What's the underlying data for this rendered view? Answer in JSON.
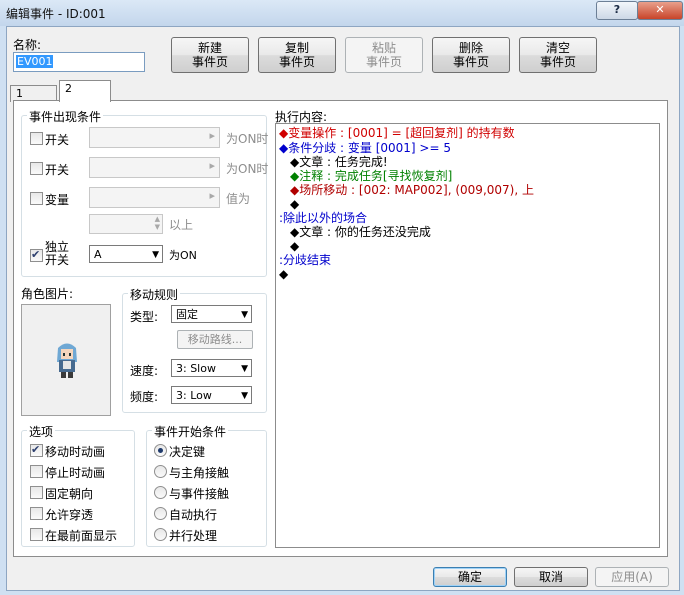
{
  "window": {
    "title": "编辑事件 - ID:001",
    "help_glyph": "?",
    "close_glyph": "✕"
  },
  "name": {
    "label": "名称:",
    "value": "EV001"
  },
  "page_buttons": [
    {
      "line1": "新建",
      "line2": "事件页",
      "enabled": true
    },
    {
      "line1": "复制",
      "line2": "事件页",
      "enabled": true
    },
    {
      "line1": "粘贴",
      "line2": "事件页",
      "enabled": false
    },
    {
      "line1": "删除",
      "line2": "事件页",
      "enabled": true
    },
    {
      "line1": "清空",
      "line2": "事件页",
      "enabled": true
    }
  ],
  "tabs": [
    {
      "label": "1"
    },
    {
      "label": "2",
      "active": true
    }
  ],
  "conditions": {
    "title": "事件出现条件",
    "switch1": {
      "label": "开关",
      "suffix": "为ON时"
    },
    "switch2": {
      "label": "开关",
      "suffix": "为ON时"
    },
    "variable": {
      "label": "变量",
      "suffix": "值为",
      "above": "以上"
    },
    "self_switch": {
      "label_line1": "独立",
      "label_line2": "开关",
      "value": "A",
      "suffix": "为ON",
      "checked": true
    }
  },
  "graphic": {
    "title": "角色图片:"
  },
  "movement": {
    "title": "移动规则",
    "type_label": "类型:",
    "type_value": "固定",
    "route_button": "移动路线...",
    "speed_label": "速度:",
    "speed_value": "3: Slow",
    "freq_label": "频度:",
    "freq_value": "3: Low"
  },
  "options": {
    "title": "选项",
    "items": [
      {
        "label": "移动时动画",
        "checked": true
      },
      {
        "label": "停止时动画",
        "checked": false
      },
      {
        "label": "固定朝向",
        "checked": false
      },
      {
        "label": "允许穿透",
        "checked": false
      },
      {
        "label": "在最前面显示",
        "checked": false
      }
    ]
  },
  "trigger": {
    "title": "事件开始条件",
    "items": [
      {
        "label": "决定键",
        "checked": true
      },
      {
        "label": "与主角接触",
        "checked": false
      },
      {
        "label": "与事件接触",
        "checked": false
      },
      {
        "label": "自动执行",
        "checked": false
      },
      {
        "label": "并行处理",
        "checked": false
      }
    ]
  },
  "contents": {
    "label": "执行内容:",
    "lines": [
      {
        "text": "◆变量操作 : [0001] = [超回复剂] 的持有数",
        "color": "#d00000",
        "indent": 0
      },
      {
        "text": "◆条件分歧 : 变量 [0001] >= 5",
        "color": "#0000cc",
        "indent": 0
      },
      {
        "text": "◆文章 : 任务完成!",
        "color": "#000000",
        "indent": 1
      },
      {
        "text": "◆注释 : 完成任务[寻找恢复剂]",
        "color": "#008000",
        "indent": 1
      },
      {
        "text": "◆场所移动 : [002: MAP002], (009,007), 上",
        "color": "#b00000",
        "indent": 1
      },
      {
        "text": "◆",
        "color": "#000000",
        "indent": 1
      },
      {
        "text": ":除此以外的场合",
        "color": "#0000cc",
        "indent": 0
      },
      {
        "text": "◆文章 : 你的任务还没完成",
        "color": "#000000",
        "indent": 1
      },
      {
        "text": "◆",
        "color": "#000000",
        "indent": 1
      },
      {
        "text": ":分歧结束",
        "color": "#0000cc",
        "indent": 0
      },
      {
        "text": "◆",
        "color": "#000000",
        "indent": 0
      }
    ]
  },
  "footer": {
    "ok": "确定",
    "cancel": "取消",
    "apply": "应用(A)"
  }
}
